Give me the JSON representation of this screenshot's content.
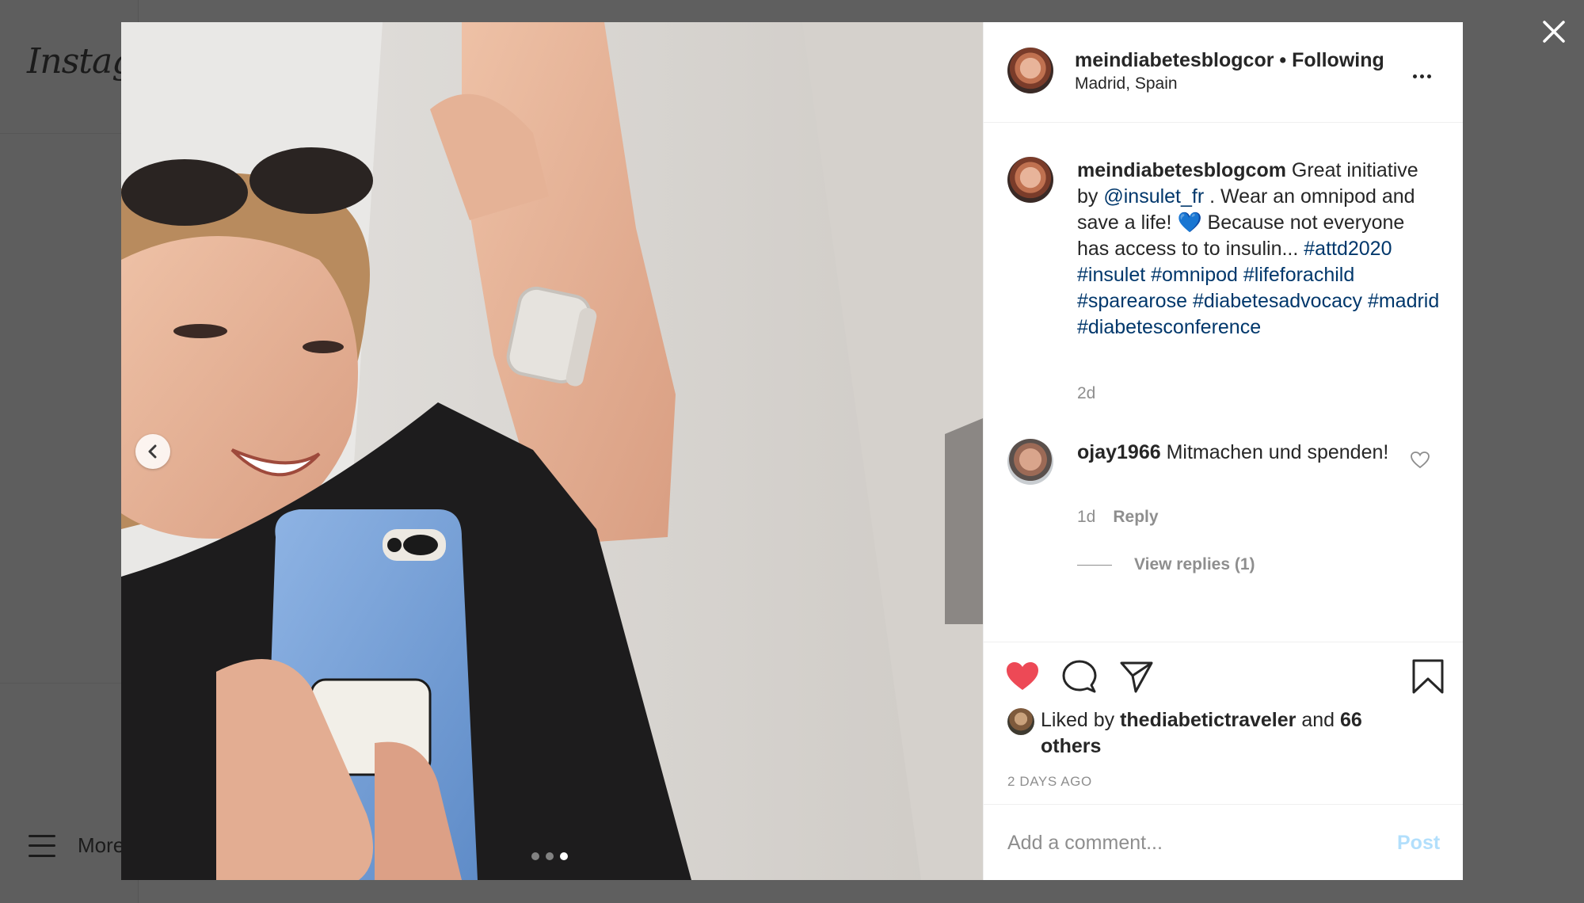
{
  "background": {
    "logo": "Instagram",
    "more_label": "More"
  },
  "post": {
    "username": "meindiabetesblogcom",
    "username_truncated": "meindiabetesblogcor",
    "follow_status": "Following",
    "separator": "•",
    "location": "Madrid, Spain",
    "carousel": {
      "slide_count": 3,
      "active_slide": 3
    },
    "caption": {
      "text_1": "Great initiative by ",
      "mention": "@insulet_fr",
      "text_2": " . Wear an omnipod and save a life! ",
      "emoji": "💙",
      "text_3": " Because not everyone has access to to insulin... ",
      "hashtags": [
        "#attd2020",
        "#insulet",
        "#omnipod",
        "#lifeforachild",
        "#sparearose",
        "#diabetesadvocacy",
        "#madrid",
        "#diabetesconference"
      ]
    },
    "caption_time": "2d",
    "comments": [
      {
        "username": "ojay1966",
        "text": "Mitmachen und spenden!",
        "time": "1d",
        "reply_label": "Reply",
        "view_replies": "View replies (1)"
      }
    ],
    "liked": true,
    "likes": {
      "prefix": "Liked by ",
      "user": "thediabetictraveler",
      "middle": " and ",
      "others": "66 others"
    },
    "timestamp": "2 DAYS AGO",
    "comment_placeholder": "Add a comment...",
    "post_label": "Post"
  },
  "colors": {
    "like_red": "#ed4956",
    "link_blue": "#00376b",
    "post_disabled": "#b2dffc",
    "muted": "#8e8e8e"
  },
  "icons": [
    "close-icon",
    "more-options-icon",
    "chevron-left-icon",
    "heart-filled-icon",
    "comment-icon",
    "share-icon",
    "bookmark-icon",
    "heart-outline-icon",
    "menu-icon"
  ]
}
